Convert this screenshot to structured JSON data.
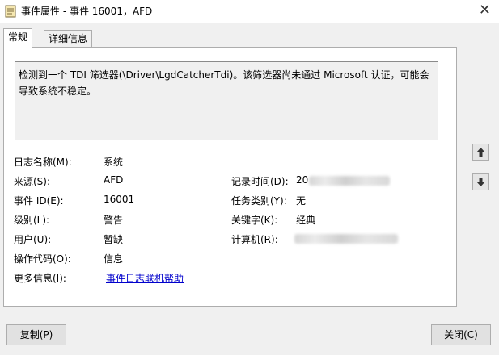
{
  "window": {
    "title": "事件属性 - 事件 16001，AFD",
    "icon": "event-viewer-icon",
    "close_label": "✕"
  },
  "tabs": [
    {
      "label": "常规",
      "active": true
    },
    {
      "label": "详细信息",
      "active": false
    }
  ],
  "description": "检测到一个 TDI 筛选器(\\Driver\\LgdCatcherTdi)。该筛选器尚未通过 Microsoft 认证，可能会导致系统不稳定。",
  "fields": {
    "log_name": {
      "label": "日志名称(M):",
      "value": "系统"
    },
    "source": {
      "label": "来源(S):",
      "value": "AFD"
    },
    "logged": {
      "label": "记录时间(D):",
      "value": "20"
    },
    "event_id": {
      "label": "事件 ID(E):",
      "value": "16001"
    },
    "task_category": {
      "label": "任务类别(Y):",
      "value": "无"
    },
    "level": {
      "label": "级别(L):",
      "value": "警告"
    },
    "keywords": {
      "label": "关键字(K):",
      "value": "经典"
    },
    "user": {
      "label": "用户(U):",
      "value": "暂缺"
    },
    "computer": {
      "label": "计算机(R):",
      "value": ""
    },
    "opcode": {
      "label": "操作代码(O):",
      "value": "信息"
    },
    "more_info": {
      "label": "更多信息(I):",
      "link": "事件日志联机帮助"
    }
  },
  "buttons": {
    "copy": "复制(P)",
    "close": "关闭(C)",
    "up": "arrow-up-icon",
    "down": "arrow-down-icon"
  }
}
